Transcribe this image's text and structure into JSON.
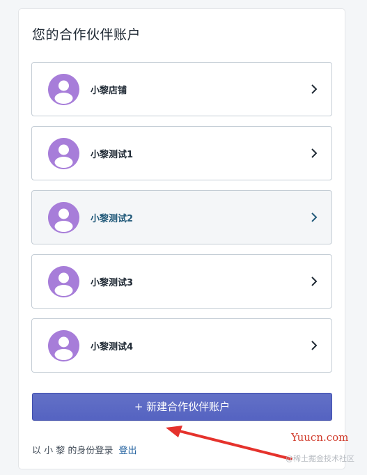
{
  "page": {
    "title": "您的合作伙伴账户"
  },
  "accounts": [
    {
      "name": "小黎店铺",
      "active": false
    },
    {
      "name": "小黎测试1",
      "active": false
    },
    {
      "name": "小黎测试2",
      "active": true
    },
    {
      "name": "小黎测试3",
      "active": false
    },
    {
      "name": "小黎测试4",
      "active": false
    }
  ],
  "actions": {
    "create_label": "+ 新建合作伙伴账户"
  },
  "footer": {
    "login_text": "以 小 黎 的身份登录",
    "logout_label": "登出"
  },
  "watermark": {
    "site": "Yuucn.com",
    "community": "@稀土掘金技术社区"
  },
  "colors": {
    "avatar": "#a77dd9",
    "primary_button": "#5c6ac4",
    "link": "#1f5f9e",
    "annotation_arrow": "#e5322c"
  },
  "icons": {
    "avatar": "user-avatar-icon",
    "row_action": "chevron-right-icon",
    "annotation": "red-arrow"
  }
}
